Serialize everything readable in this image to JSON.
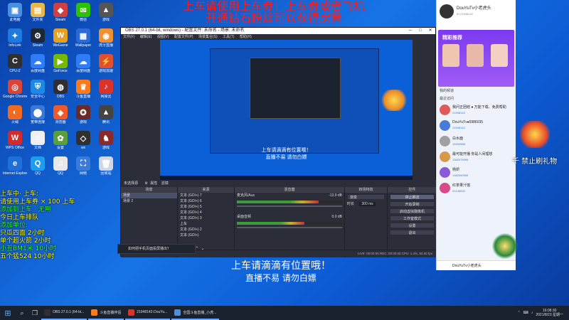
{
  "overlay_top": {
    "line1": "上车请使用上车券：上车券或者飞机",
    "line2": "开通钻石粉丝可以获得房管"
  },
  "desktop_icons": [
    {
      "label": "此电脑",
      "color": "#4a8fe0",
      "glyph": "▣"
    },
    {
      "label": "文件夹",
      "color": "#e8b84a",
      "glyph": "▤"
    },
    {
      "label": "Steam",
      "color": "#d04040",
      "glyph": "◆"
    },
    {
      "label": "微信",
      "color": "#2dc100",
      "glyph": "✉"
    },
    {
      "label": "游戏",
      "color": "#555555",
      "glyph": "▲"
    },
    {
      "label": "InfoLink",
      "color": "#1f7ae0",
      "glyph": "✦"
    },
    {
      "label": "Steam",
      "color": "#1b2838",
      "glyph": "⚙"
    },
    {
      "label": "WeGame",
      "color": "#e8a020",
      "glyph": "W"
    },
    {
      "label": "Wallpaper",
      "color": "#2a6bd8",
      "glyph": "▦"
    },
    {
      "label": "虎牙直播",
      "color": "#f09030",
      "glyph": "◉"
    },
    {
      "label": "CPU-Z",
      "color": "#303030",
      "glyph": "C"
    },
    {
      "label": "百度网盘",
      "color": "#2f7cf6",
      "glyph": "☁"
    },
    {
      "label": "GeForce",
      "color": "#76b900",
      "glyph": "▶"
    },
    {
      "label": "百度网盘",
      "color": "#2f7cf6",
      "glyph": "☁"
    },
    {
      "label": "游戏加速",
      "color": "#e04f2f",
      "glyph": "⚡"
    },
    {
      "label": "Google Chrome",
      "color": "#db4437",
      "glyph": "◎"
    },
    {
      "label": "安全中心",
      "color": "#1e88e5",
      "glyph": "⛨"
    },
    {
      "label": "OBS",
      "color": "#302e31",
      "glyph": "◍"
    },
    {
      "label": "斗鱼直播",
      "color": "#ff7a1a",
      "glyph": "♛"
    },
    {
      "label": "网易云",
      "color": "#d9332a",
      "glyph": "♪"
    },
    {
      "label": "火绒",
      "color": "#f06a20",
      "glyph": "◐"
    },
    {
      "label": "宽带连接",
      "color": "#3a78d8",
      "glyph": "⬤"
    },
    {
      "label": "浏览器",
      "color": "#f05a28",
      "glyph": "◈"
    },
    {
      "label": "游戏",
      "color": "#6a2a2a",
      "glyph": "✪"
    },
    {
      "label": "腾讯",
      "color": "#444444",
      "glyph": "▲"
    },
    {
      "label": "WPS Office",
      "color": "#d42a2a",
      "glyph": "W"
    },
    {
      "label": "文档",
      "color": "#f0f0f0",
      "glyph": "≡"
    },
    {
      "label": "设置",
      "color": "#5aa03a",
      "glyph": "✿"
    },
    {
      "label": "wx",
      "color": "#303030",
      "glyph": "◇"
    },
    {
      "label": "游戏",
      "color": "#8a2a2a",
      "glyph": "♞"
    },
    {
      "label": "Internet Explorer",
      "color": "#1e6fd8",
      "glyph": "e"
    },
    {
      "label": "QQ",
      "color": "#1e9cf0",
      "glyph": "Q"
    },
    {
      "label": "QQ",
      "color": "#e8e8e8",
      "glyph": "♫"
    },
    {
      "label": "网络",
      "color": "#3a7ad8",
      "glyph": "⛶"
    },
    {
      "label": "回收站",
      "color": "#cfd8e8",
      "glyph": "🗑"
    }
  ],
  "obs": {
    "title": "OBS 27.0.1 (64-bit, windows) - 配置文件: 未命名 - 场景: 未命名",
    "menu": [
      "文件(F)",
      "编辑(E)",
      "视图(V)",
      "配置文件(P)",
      "场景集合(S)",
      "工具(T)",
      "帮助(H)"
    ],
    "preview_caption_1": "上车请滴滴有位置哦！",
    "preview_caption_2": "直播不易 请勿白嫖",
    "scenes_bar_label": "未选择源",
    "props_label": "属性",
    "filters_label": "滤镜",
    "docks": {
      "scenes": {
        "header": "场景",
        "items": [
          "场景",
          "场景 2"
        ]
      },
      "sources": {
        "header": "来源",
        "items": [
          "文本 (GDI+) 7",
          "文本 (GDI+) 6",
          "文本 (GDI+) 5",
          "文本 (GDI+) 4",
          "文本 (GDI+) 3",
          "上车",
          "文本 (GDI+) 2",
          "文本 (GDI+)"
        ]
      },
      "mixer": {
        "header": "混音器",
        "tracks": [
          {
            "name": "麦克风/Aux",
            "db": "-13.9 dB",
            "level": 0.78
          },
          {
            "name": "桌面音频",
            "db": "0.0 dB",
            "level": 0.64
          }
        ]
      },
      "transitions": {
        "header": "转场特效",
        "type": "渐变",
        "duration_label": "时长",
        "duration": "300 ms"
      },
      "controls": {
        "header": "控件",
        "buttons": [
          "停止推流",
          "开始录制",
          "启动虚拟摄像机",
          "工作室模式",
          "设置",
          "退出"
        ]
      }
    },
    "status": "LIVE: 00:00:00   REC: 00:00:00   CPU: 1.4%, 60.00 fps"
  },
  "notification": "如何把手机页面投屏播出？",
  "left_overlay": [
    {
      "text": "上车中·  上车:",
      "color": "yellow"
    },
    {
      "text": "请使用上车券 × 100 上车",
      "color": "yellow"
    },
    {
      "text": "添加到上车 · 无用",
      "color": "green"
    },
    {
      "text": "今日上车排队",
      "color": "yellow"
    },
    {
      "text": "添加单位:",
      "color": "green"
    },
    {
      "text": "  只瓜四面  2小时",
      "color": "yellow"
    },
    {
      "text": "单个超火箭       2小时",
      "color": "yellow"
    },
    {
      "text": "小丑BM1米        10小时",
      "color": "green"
    },
    {
      "text": "五个猛524        10小时",
      "color": "yellow"
    }
  ],
  "bottom_caption": {
    "line1": "上车请滴滴有位置哦！",
    "line2": "直播不易 请勿白嫖"
  },
  "chat_panel": {
    "name": "DouYuTv小老虎头",
    "sub": "ID:21948142",
    "banner_title": "精彩推荐",
    "section_1": "我的频道",
    "section_2": "最近访问",
    "items": [
      {
        "name": "我问正团结 ● 万能下载、免费帮助",
        "sub": "21948142",
        "color": "#e05a5a"
      },
      {
        "name": "DouYuTv●5986035",
        "sub": "21948142",
        "color": "#4a7ad8"
      },
      {
        "name": "白水面",
        "sub": "10253988",
        "color": "#a0a0a0"
      },
      {
        "name": "最可能开播 你是人间理想",
        "sub": "1382579095",
        "color": "#d89a4a"
      },
      {
        "name": "杨妍",
        "sub": "1382590950",
        "color": "#8a5ad8"
      },
      {
        "name": "红茶果汁馆",
        "sub": "22148092",
        "color": "#d84a8a"
      }
    ],
    "footer": "DouYuTv小老虎头"
  },
  "right_text": "千 禁止刷礼物",
  "taskbar": {
    "tasks": [
      {
        "label": "OBS 27.0.1 (64-bi...",
        "color": "#302e31"
      },
      {
        "label": "斗鱼直播伴侣",
        "color": "#ff7a1a"
      },
      {
        "label": "21948142-DouYu...",
        "color": "#d9332a"
      },
      {
        "label": "全国斗鱼直播_小虎...",
        "color": "#4a8fe0"
      }
    ],
    "time": "16:08:30",
    "date": "2021/8/23 星期一"
  }
}
